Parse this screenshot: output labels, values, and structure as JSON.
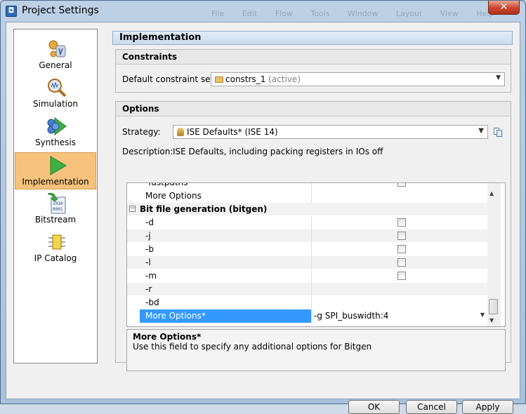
{
  "window": {
    "title": "Project Settings",
    "close_glyph": "✕",
    "background_menu": [
      "File",
      "Edit",
      "Flow",
      "Tools",
      "Window",
      "Layout",
      "View",
      "Help"
    ]
  },
  "nav": {
    "items": [
      {
        "label": "General",
        "icon": "general-icon"
      },
      {
        "label": "Simulation",
        "icon": "simulation-icon"
      },
      {
        "label": "Synthesis",
        "icon": "synthesis-icon"
      },
      {
        "label": "Implementation",
        "icon": "implementation-icon",
        "selected": true
      },
      {
        "label": "Bitstream",
        "icon": "bitstream-icon"
      },
      {
        "label": "IP Catalog",
        "icon": "ip-catalog-icon"
      }
    ]
  },
  "header": {
    "title": "Implementation"
  },
  "constraints": {
    "title": "Constraints",
    "label": "Default constraint set:",
    "value": "constrs_1",
    "value_suffix": "(active)"
  },
  "options": {
    "title": "Options",
    "strategy_label": "Strategy:",
    "strategy_value": "ISE Defaults* (ISE 14)",
    "description_label": "Description:",
    "description_value": "ISE Defaults, including packing registers in IOs off"
  },
  "table": {
    "rows": [
      {
        "name": "-fastpaths",
        "type": "checkbox",
        "checked": false
      },
      {
        "name": "More Options",
        "type": "text",
        "value": ""
      },
      {
        "name": "Bit file generation (bitgen)",
        "type": "group"
      },
      {
        "name": "-d",
        "type": "checkbox",
        "checked": false
      },
      {
        "name": "-j",
        "type": "checkbox",
        "checked": false
      },
      {
        "name": "-b",
        "type": "checkbox",
        "checked": false
      },
      {
        "name": "-l",
        "type": "checkbox",
        "checked": false
      },
      {
        "name": "-m",
        "type": "checkbox",
        "checked": false
      },
      {
        "name": "-r",
        "type": "text",
        "value": ""
      },
      {
        "name": "-bd",
        "type": "text",
        "value": ""
      },
      {
        "name": "More Options*",
        "type": "dropdown",
        "value": "-g SPI_buswidth:4",
        "selected": true
      }
    ]
  },
  "help": {
    "title": "More Options*",
    "text": "Use this field to specify any additional options for Bitgen"
  },
  "buttons": {
    "ok": "OK",
    "cancel": "Cancel",
    "apply": "Apply"
  },
  "colors": {
    "selection": "#3399ff",
    "nav_selected": "#f7c27b",
    "header": "#c9dbef"
  }
}
